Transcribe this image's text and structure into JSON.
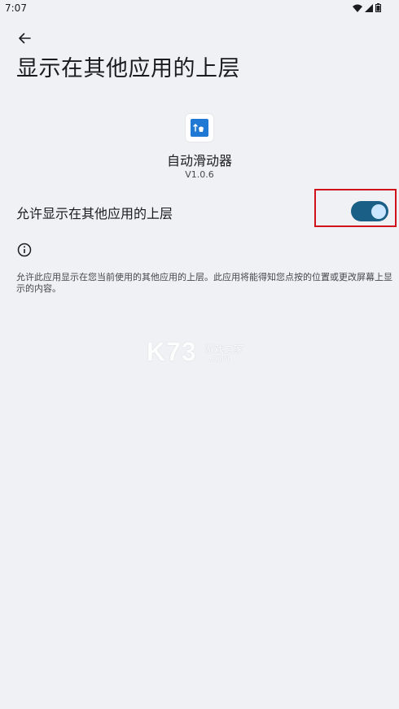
{
  "status_bar": {
    "time": "7:07",
    "icons": [
      "wifi-icon",
      "cellular-signal-icon",
      "battery-icon"
    ]
  },
  "page": {
    "title": "显示在其他应用的上层"
  },
  "app": {
    "name": "自动滑动器",
    "version": "V1.0.6"
  },
  "permission": {
    "label": "允许显示在其他应用的上层",
    "enabled": true,
    "description": "允许此应用显示在您当前使用的其他应用的上层。此应用将能得知您点按的位置或更改屏幕上显示的内容。"
  },
  "watermark": {
    "main": "K73",
    "sub": "游戏之家",
    "domain": ".com"
  },
  "colors": {
    "background": "#f0f1f4",
    "toggle_track": "#1a5f86",
    "toggle_thumb": "#cbe6ff",
    "highlight": "#d0121b"
  }
}
